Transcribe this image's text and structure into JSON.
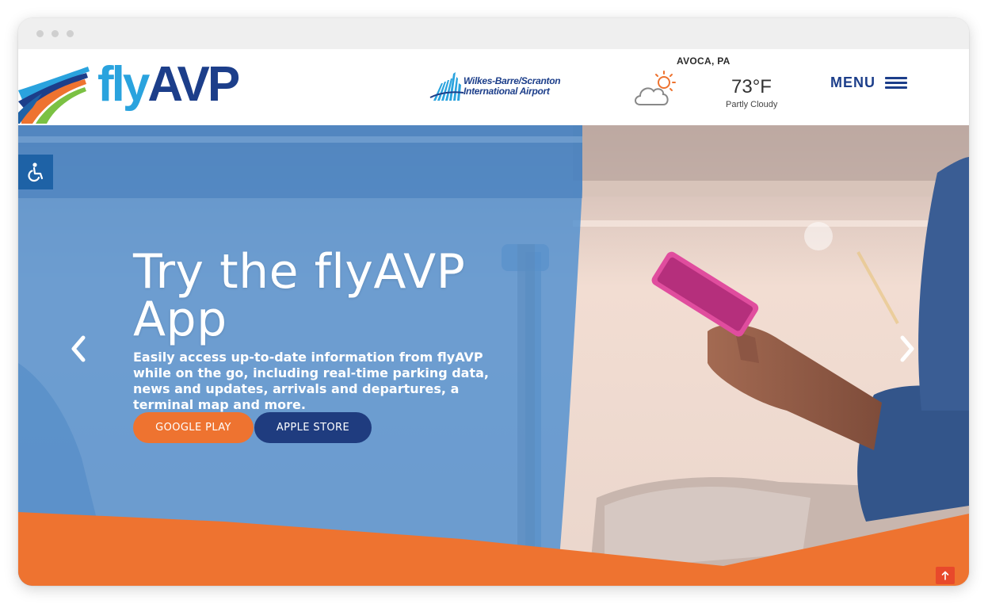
{
  "header": {
    "logo": {
      "prefix": "fly",
      "suffix": "AVP"
    },
    "airport": {
      "line1": "Wilkes-Barre/Scranton",
      "line2": "International Airport"
    },
    "weather": {
      "location": "AVOCA, PA",
      "temperature": "73°F",
      "condition": "Partly Cloudy",
      "icon": "partly-cloudy-icon"
    },
    "menu_label": "MENU"
  },
  "hero": {
    "title": "Try the flyAVP App",
    "description": "Easily access up-to-date information from flyAVP while on the go, including real-time parking data, news and updates, arrivals and departures, a terminal map and more.",
    "buttons": {
      "google": "GOOGLE PLAY",
      "apple": "APPLE STORE"
    }
  },
  "icons": {
    "accessibility": "wheelchair-icon",
    "prev": "chevron-left-icon",
    "next": "chevron-right-icon",
    "scroll_top": "arrow-up-icon",
    "menu": "hamburger-icon"
  },
  "colors": {
    "brand_dark_blue": "#1c3e8a",
    "brand_light_blue": "#2aa3de",
    "accent_orange": "#ee7330",
    "overlay_blue": "#4f8fcf",
    "scroll_top_red": "#e8492b"
  }
}
